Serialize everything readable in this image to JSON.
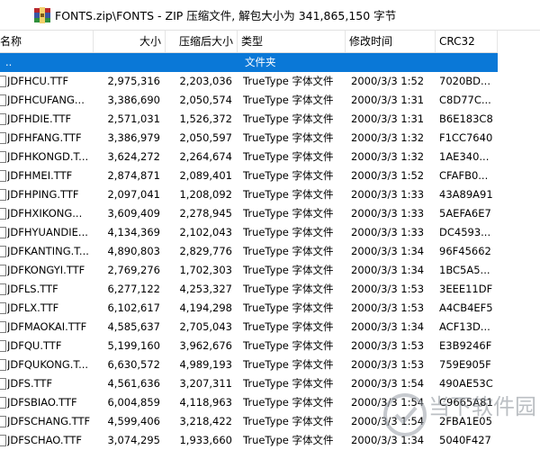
{
  "pathbar": {
    "path": "FONTS.zip\\FONTS - ZIP 压缩文件, 解包大小为 341,865,150 字节"
  },
  "columns": {
    "name": "名称",
    "size": "大小",
    "packed": "压缩后大小",
    "type": "类型",
    "modified": "修改时间",
    "crc": "CRC32"
  },
  "parent_row": {
    "name": "..",
    "type": "文件夹"
  },
  "files": [
    {
      "name": "JDFHCU.TTF",
      "size": "2,975,316",
      "packed": "2,203,036",
      "type": "TrueType 字体文件",
      "modified": "2000/3/3 1:52",
      "crc": "7020BD..."
    },
    {
      "name": "JDFHCUFANG...",
      "size": "3,386,690",
      "packed": "2,050,574",
      "type": "TrueType 字体文件",
      "modified": "2000/3/3 1:31",
      "crc": "C8D77C..."
    },
    {
      "name": "JDFHDIE.TTF",
      "size": "2,571,031",
      "packed": "1,526,372",
      "type": "TrueType 字体文件",
      "modified": "2000/3/3 1:31",
      "crc": "B6E183C8"
    },
    {
      "name": "JDFHFANG.TTF",
      "size": "3,386,979",
      "packed": "2,050,597",
      "type": "TrueType 字体文件",
      "modified": "2000/3/3 1:32",
      "crc": "F1CC7640"
    },
    {
      "name": "JDFHKONGD.T...",
      "size": "3,624,272",
      "packed": "2,264,674",
      "type": "TrueType 字体文件",
      "modified": "2000/3/3 1:32",
      "crc": "1AE340..."
    },
    {
      "name": "JDFHMEI.TTF",
      "size": "2,874,871",
      "packed": "2,089,401",
      "type": "TrueType 字体文件",
      "modified": "2000/3/3 1:52",
      "crc": "CFAFB0..."
    },
    {
      "name": "JDFHPING.TTF",
      "size": "2,097,041",
      "packed": "1,208,092",
      "type": "TrueType 字体文件",
      "modified": "2000/3/3 1:33",
      "crc": "43A89A91"
    },
    {
      "name": "JDFHXIKONG...",
      "size": "3,609,409",
      "packed": "2,278,945",
      "type": "TrueType 字体文件",
      "modified": "2000/3/3 1:33",
      "crc": "5AEFA6E7"
    },
    {
      "name": "JDFHYUANDIE...",
      "size": "4,134,369",
      "packed": "2,102,043",
      "type": "TrueType 字体文件",
      "modified": "2000/3/3 1:33",
      "crc": "DC4593..."
    },
    {
      "name": "JDFKANTING.T...",
      "size": "4,890,803",
      "packed": "2,829,776",
      "type": "TrueType 字体文件",
      "modified": "2000/3/3 1:34",
      "crc": "96F45662"
    },
    {
      "name": "JDFKONGYI.TTF",
      "size": "2,769,276",
      "packed": "1,702,303",
      "type": "TrueType 字体文件",
      "modified": "2000/3/3 1:34",
      "crc": "1BC5A5..."
    },
    {
      "name": "JDFLS.TTF",
      "size": "6,277,122",
      "packed": "4,253,327",
      "type": "TrueType 字体文件",
      "modified": "2000/3/3 1:53",
      "crc": "3EEE11DF"
    },
    {
      "name": "JDFLX.TTF",
      "size": "6,102,617",
      "packed": "4,194,298",
      "type": "TrueType 字体文件",
      "modified": "2000/3/3 1:53",
      "crc": "A4CB4EF5"
    },
    {
      "name": "JDFMAOKAI.TTF",
      "size": "4,585,637",
      "packed": "2,705,043",
      "type": "TrueType 字体文件",
      "modified": "2000/3/3 1:34",
      "crc": "ACF13D..."
    },
    {
      "name": "JDFQU.TTF",
      "size": "5,199,160",
      "packed": "3,962,676",
      "type": "TrueType 字体文件",
      "modified": "2000/3/3 1:53",
      "crc": "E3B9246F"
    },
    {
      "name": "JDFQUKONG.T...",
      "size": "6,630,572",
      "packed": "4,989,193",
      "type": "TrueType 字体文件",
      "modified": "2000/3/3 1:53",
      "crc": "759E905F"
    },
    {
      "name": "JDFS.TTF",
      "size": "4,561,636",
      "packed": "3,207,311",
      "type": "TrueType 字体文件",
      "modified": "2000/3/3 1:54",
      "crc": "490AE53C"
    },
    {
      "name": "JDFSBIAO.TTF",
      "size": "6,004,859",
      "packed": "4,118,963",
      "type": "TrueType 字体文件",
      "modified": "2000/3/3 1:54",
      "crc": "C9665A81"
    },
    {
      "name": "JDFSCHANG.TTF",
      "size": "4,599,406",
      "packed": "3,218,422",
      "type": "TrueType 字体文件",
      "modified": "2000/3/3 1:54",
      "crc": "2FBA1E05"
    },
    {
      "name": "JDFSCHAO.TTF",
      "size": "3,074,295",
      "packed": "1,933,660",
      "type": "TrueType 字体文件",
      "modified": "2000/3/3 1:34",
      "crc": "5040F427"
    }
  ],
  "watermark": {
    "text": "当下软件园"
  },
  "colors": {
    "selection": "#0a78d7",
    "rar_icon_red": "#b8282e",
    "rar_icon_blue": "#3a55a4"
  }
}
